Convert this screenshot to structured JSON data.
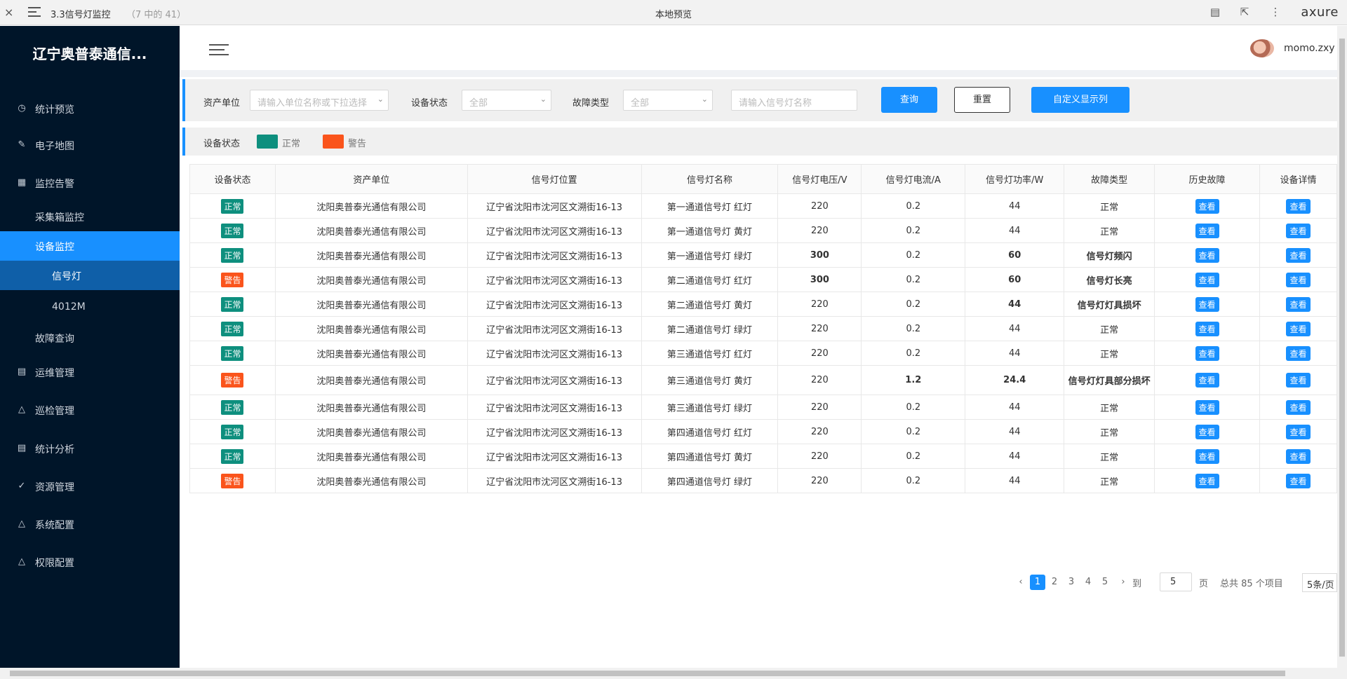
{
  "topbar": {
    "close": "×",
    "page_title": "3.3信号灯监控",
    "page_count": "（7 中的 41）",
    "center": "本地预览",
    "logo": "axure"
  },
  "sidebar": {
    "brand": "辽宁奥普泰通信...",
    "items": [
      {
        "label": "统计预览",
        "icon": "dashboard-icon",
        "glyph": "◷"
      },
      {
        "label": "电子地图",
        "icon": "edit-icon",
        "glyph": "✎"
      },
      {
        "label": "监控告警",
        "icon": "table-icon",
        "glyph": "▦"
      },
      {
        "label": "运维管理",
        "icon": "document-icon",
        "glyph": "▤"
      },
      {
        "label": "巡检管理",
        "icon": "warning-icon",
        "glyph": "△"
      },
      {
        "label": "统计分析",
        "icon": "document-icon",
        "glyph": "▤"
      },
      {
        "label": "资源管理",
        "icon": "check-circle-icon",
        "glyph": "✓"
      },
      {
        "label": "系统配置",
        "icon": "warning-icon",
        "glyph": "△"
      },
      {
        "label": "权限配置",
        "icon": "warning-icon",
        "glyph": "△"
      }
    ],
    "subitems": [
      {
        "label": "采集箱监控"
      },
      {
        "label": "设备监控"
      },
      {
        "label": "信号灯"
      },
      {
        "label": "4012M"
      },
      {
        "label": "故障查询"
      }
    ]
  },
  "header": {
    "username": "momo.zxy"
  },
  "filter": {
    "unit_label": "资产单位",
    "unit_placeholder": "请输入单位名称或下拉选择",
    "status_label": "设备状态",
    "status_value": "全部",
    "fault_label": "故障类型",
    "fault_value": "全部",
    "name_placeholder": "请输入信号灯名称",
    "query_btn": "查询",
    "reset_btn": "重置",
    "custom_btn": "自定义显示列"
  },
  "legend": {
    "title": "设备状态",
    "normal": "正常",
    "warning": "警告",
    "normal_color": "#0e8f7e",
    "warning_color": "#fa541c"
  },
  "table": {
    "headers": [
      "设备状态",
      "资产单位",
      "信号灯位置",
      "信号灯名称",
      "信号灯电压/V",
      "信号灯电流/A",
      "信号灯功率/W",
      "故障类型",
      "历史故障",
      "设备详情"
    ],
    "view_label": "查看",
    "rows": [
      {
        "status": "正常",
        "unit": "沈阳奥普泰光通信有限公司",
        "loc": "辽宁省沈阳市沈河区文溯街16-13",
        "name": "第一通道信号灯  红灯",
        "v": "220",
        "a": "0.2",
        "w": "44",
        "fault": "正常"
      },
      {
        "status": "正常",
        "unit": "沈阳奥普泰光通信有限公司",
        "loc": "辽宁省沈阳市沈河区文溯街16-13",
        "name": "第一通道信号灯  黄灯",
        "v": "220",
        "a": "0.2",
        "w": "44",
        "fault": "正常"
      },
      {
        "status": "正常",
        "unit": "沈阳奥普泰光通信有限公司",
        "loc": "辽宁省沈阳市沈河区文溯街16-13",
        "name": "第一通道信号灯  绿灯",
        "v": "300",
        "a": "0.2",
        "w": "60",
        "fault": "信号灯频闪"
      },
      {
        "status": "警告",
        "unit": "沈阳奥普泰光通信有限公司",
        "loc": "辽宁省沈阳市沈河区文溯街16-13",
        "name": "第二通道信号灯  红灯",
        "v": "300",
        "a": "0.2",
        "w": "60",
        "fault": "信号灯长亮"
      },
      {
        "status": "正常",
        "unit": "沈阳奥普泰光通信有限公司",
        "loc": "辽宁省沈阳市沈河区文溯街16-13",
        "name": "第二通道信号灯  黄灯",
        "v": "220",
        "a": "0.2",
        "w": "44",
        "fault": "信号灯灯具损坏"
      },
      {
        "status": "正常",
        "unit": "沈阳奥普泰光通信有限公司",
        "loc": "辽宁省沈阳市沈河区文溯街16-13",
        "name": "第二通道信号灯  绿灯",
        "v": "220",
        "a": "0.2",
        "w": "44",
        "fault": "正常"
      },
      {
        "status": "正常",
        "unit": "沈阳奥普泰光通信有限公司",
        "loc": "辽宁省沈阳市沈河区文溯街16-13",
        "name": "第三通道信号灯  红灯",
        "v": "220",
        "a": "0.2",
        "w": "44",
        "fault": "正常"
      },
      {
        "status": "警告",
        "unit": "沈阳奥普泰光通信有限公司",
        "loc": "辽宁省沈阳市沈河区文溯街16-13",
        "name": "第三通道信号灯  黄灯",
        "v": "220",
        "a": "1.2",
        "w": "24.4",
        "fault": "信号灯灯具部分损坏"
      },
      {
        "status": "正常",
        "unit": "沈阳奥普泰光通信有限公司",
        "loc": "辽宁省沈阳市沈河区文溯街16-13",
        "name": "第三通道信号灯  绿灯",
        "v": "220",
        "a": "0.2",
        "w": "44",
        "fault": "正常"
      },
      {
        "status": "正常",
        "unit": "沈阳奥普泰光通信有限公司",
        "loc": "辽宁省沈阳市沈河区文溯街16-13",
        "name": "第四通道信号灯  红灯",
        "v": "220",
        "a": "0.2",
        "w": "44",
        "fault": "正常"
      },
      {
        "status": "正常",
        "unit": "沈阳奥普泰光通信有限公司",
        "loc": "辽宁省沈阳市沈河区文溯街16-13",
        "name": "第四通道信号灯  黄灯",
        "v": "220",
        "a": "0.2",
        "w": "44",
        "fault": "正常"
      },
      {
        "status": "警告",
        "unit": "沈阳奥普泰光通信有限公司",
        "loc": "辽宁省沈阳市沈河区文溯街16-13",
        "name": "第四通道信号灯  绿灯",
        "v": "220",
        "a": "0.2",
        "w": "44",
        "fault": "正常"
      }
    ]
  },
  "pagination": {
    "prev": "‹",
    "pages": [
      "1",
      "2",
      "3",
      "4",
      "5"
    ],
    "next": "›",
    "goto": "到",
    "page_input": "5",
    "page_unit": "页",
    "total": "总共 85 个项目",
    "page_size": "5条/页"
  }
}
